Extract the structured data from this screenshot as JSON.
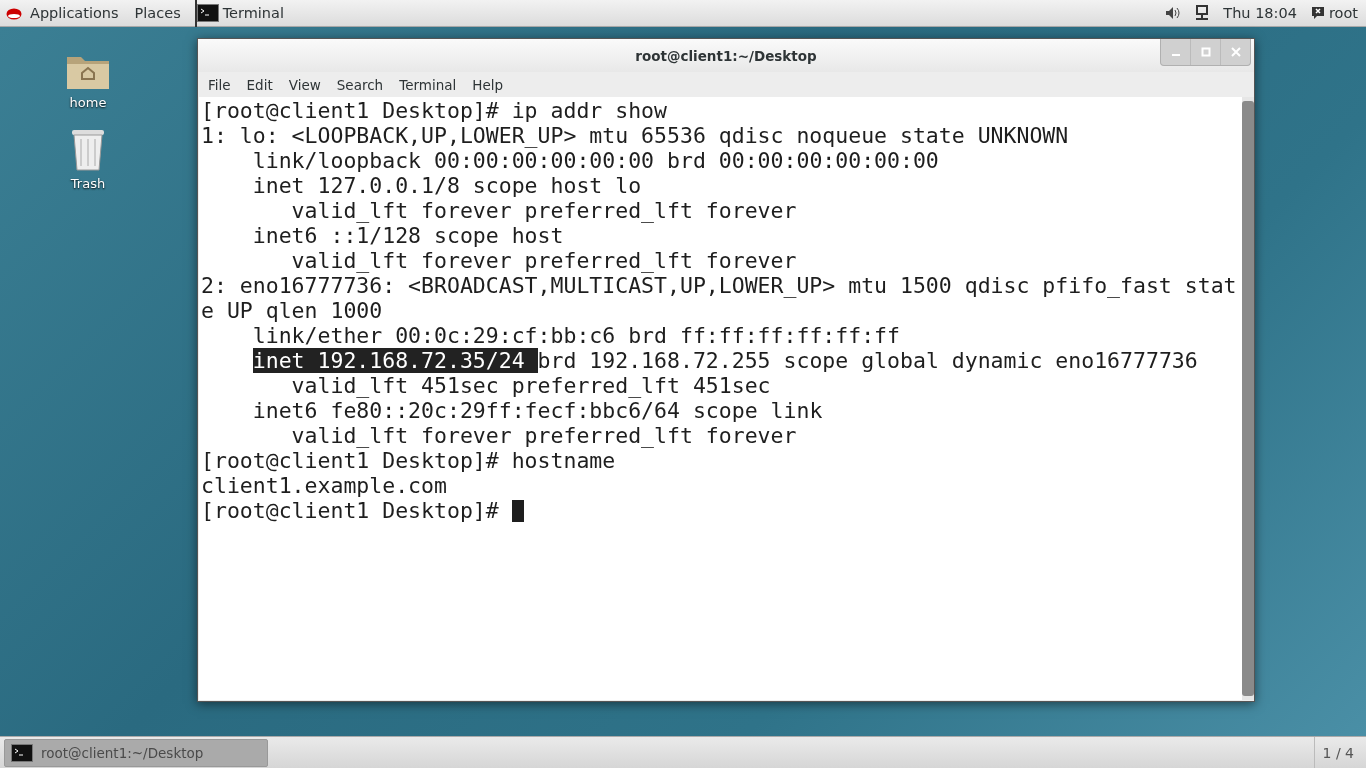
{
  "top_bar": {
    "menus": [
      "Applications",
      "Places"
    ],
    "active_app": "Terminal",
    "clock": "Thu 18:04",
    "user": "root"
  },
  "desktop_icons": [
    {
      "kind": "folder",
      "label": "home"
    },
    {
      "kind": "trash",
      "label": "Trash"
    }
  ],
  "window": {
    "title": "root@client1:~/Desktop",
    "menu": [
      "File",
      "Edit",
      "View",
      "Search",
      "Terminal",
      "Help"
    ],
    "lines": [
      [
        {
          "text": "[root@client1 Desktop]# ip addr show",
          "selected": false
        }
      ],
      [
        {
          "text": "1: lo: <LOOPBACK,UP,LOWER_UP> mtu 65536 qdisc noqueue state UNKNOWN",
          "selected": false
        }
      ],
      [
        {
          "text": "    link/loopback 00:00:00:00:00:00 brd 00:00:00:00:00:00",
          "selected": false
        }
      ],
      [
        {
          "text": "    inet 127.0.0.1/8 scope host lo",
          "selected": false
        }
      ],
      [
        {
          "text": "       valid_lft forever preferred_lft forever",
          "selected": false
        }
      ],
      [
        {
          "text": "    inet6 ::1/128 scope host",
          "selected": false
        }
      ],
      [
        {
          "text": "       valid_lft forever preferred_lft forever",
          "selected": false
        }
      ],
      [
        {
          "text": "2: eno16777736: <BROADCAST,MULTICAST,UP,LOWER_UP> mtu 1500 qdisc pfifo_fast stat",
          "selected": false
        }
      ],
      [
        {
          "text": "e UP qlen 1000",
          "selected": false
        }
      ],
      [
        {
          "text": "    link/ether 00:0c:29:cf:bb:c6 brd ff:ff:ff:ff:ff:ff",
          "selected": false
        }
      ],
      [
        {
          "text": "    inet 192.168.72.35/24 ",
          "selected": true
        },
        {
          "text": "brd 192.168.72.255 scope global dynamic eno16777736",
          "selected": false
        }
      ],
      [
        {
          "text": "       valid_lft 451sec preferred_lft 451sec",
          "selected": false
        }
      ],
      [
        {
          "text": "    inet6 fe80::20c:29ff:fecf:bbc6/64 scope link",
          "selected": false
        }
      ],
      [
        {
          "text": "       valid_lft forever preferred_lft forever",
          "selected": false
        }
      ],
      [
        {
          "text": "[root@client1 Desktop]# hostname",
          "selected": false
        }
      ],
      [
        {
          "text": "client1.example.com",
          "selected": false
        }
      ],
      [
        {
          "text": "[root@client1 Desktop]# ",
          "selected": false
        }
      ]
    ]
  },
  "taskbar": {
    "items": [
      {
        "label": "root@client1:~/Desktop",
        "selected": true
      }
    ],
    "workspace": "1 / 4"
  }
}
